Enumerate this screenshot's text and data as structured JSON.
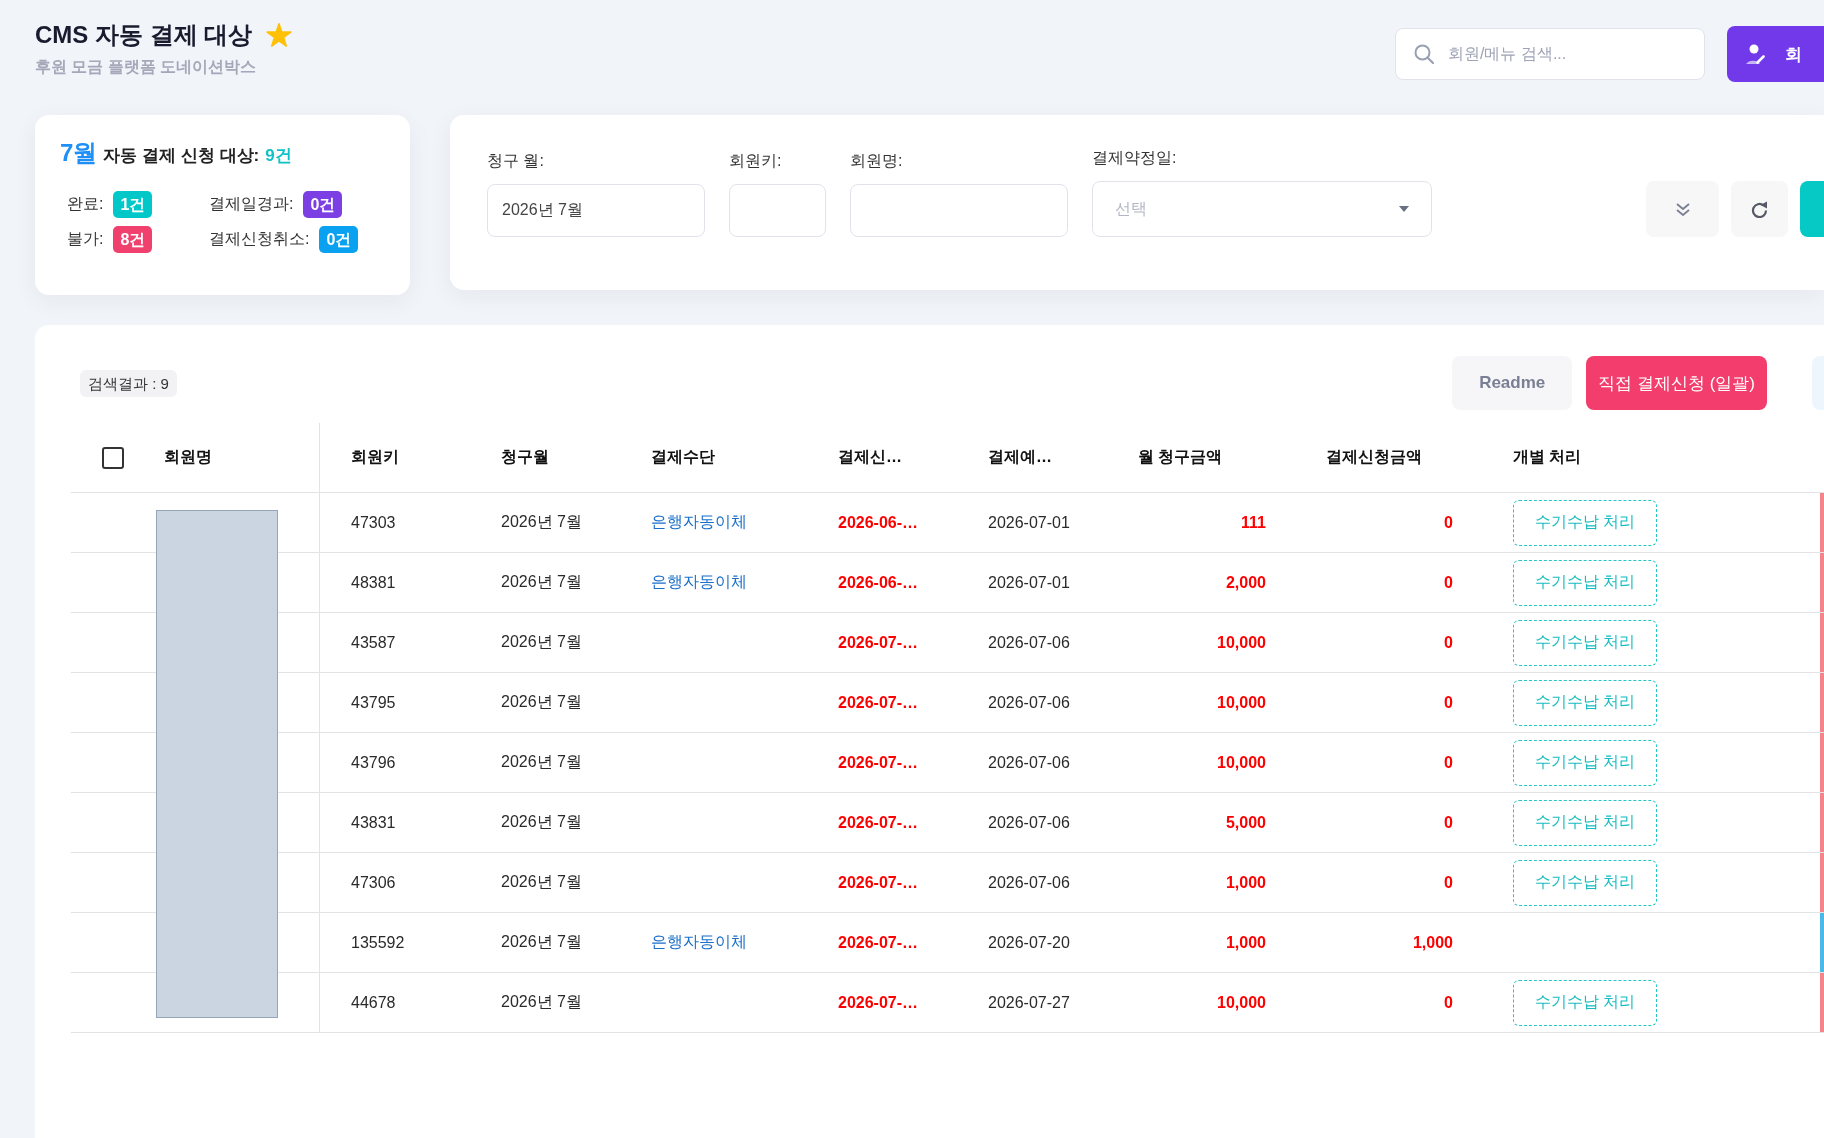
{
  "header": {
    "title": "CMS 자동 결제 대상",
    "favorite": true,
    "subtitle": "후원 모금 플랫폼 도네이션박스",
    "search": {
      "placeholder": "회원/메뉴 검색..."
    },
    "member_button": {
      "label": "회"
    }
  },
  "summary": {
    "month": "7월",
    "title": "자동 결제 신청 대상:",
    "total": "9건",
    "stats": [
      {
        "label": "완료:",
        "count": "1건",
        "color": "#00c8c8"
      },
      {
        "label": "결제일경과:",
        "count": "0건",
        "color": "#7b3fe4"
      },
      {
        "label": "불가:",
        "count": "8건",
        "color": "#f0406e"
      },
      {
        "label": "결제신청취소:",
        "count": "0건",
        "color": "#0aa2f0"
      }
    ]
  },
  "filters": {
    "fields": [
      {
        "kind": "input",
        "label": "청구 월:",
        "value": "2026년 7월"
      },
      {
        "kind": "input",
        "label": "회원키:"
      },
      {
        "kind": "input",
        "label": "회원명:"
      },
      {
        "kind": "select",
        "label": "결제약정일:",
        "placeholder": "선택"
      }
    ]
  },
  "results": {
    "count": "검색결과 : 9",
    "buttons": [
      {
        "kind": "secondary",
        "label": "Readme"
      },
      {
        "kind": "danger",
        "label": "직접 결제신청 (일괄)"
      }
    ]
  },
  "table": {
    "select_all": {
      "checked": false
    },
    "columns": [
      "회원명",
      "회원키",
      "청구월",
      "결제수단",
      "결제신…",
      "결제예…",
      "월 청구금액",
      "결제신청금액",
      "개별 처리"
    ],
    "rows": [
      {
        "member_key": "47303",
        "billing_month": "2026년 7월",
        "payment_method": "은행자동이체",
        "request_date": "2026-06-…",
        "due_date": "2026-07-01",
        "monthly_amount": "111",
        "request_amount": "0",
        "action": "수기수납 처리",
        "color": "#f2848a"
      },
      {
        "member_key": "48381",
        "billing_month": "2026년 7월",
        "payment_method": "은행자동이체",
        "request_date": "2026-06-…",
        "due_date": "2026-07-01",
        "monthly_amount": "2,000",
        "request_amount": "0",
        "action": "수기수납 처리",
        "color": "#f2848a"
      },
      {
        "member_key": "43587",
        "billing_month": "2026년 7월",
        "request_date": "2026-07-…",
        "due_date": "2026-07-06",
        "monthly_amount": "10,000",
        "request_amount": "0",
        "action": "수기수납 처리",
        "color": "#f2848a"
      },
      {
        "member_key": "43795",
        "billing_month": "2026년 7월",
        "request_date": "2026-07-…",
        "due_date": "2026-07-06",
        "monthly_amount": "10,000",
        "request_amount": "0",
        "action": "수기수납 처리",
        "color": "#f2848a"
      },
      {
        "member_key": "43796",
        "billing_month": "2026년 7월",
        "request_date": "2026-07-…",
        "due_date": "2026-07-06",
        "monthly_amount": "10,000",
        "request_amount": "0",
        "action": "수기수납 처리",
        "color": "#f2848a"
      },
      {
        "member_key": "43831",
        "billing_month": "2026년 7월",
        "request_date": "2026-07-…",
        "due_date": "2026-07-06",
        "monthly_amount": "5,000",
        "request_amount": "0",
        "action": "수기수납 처리",
        "color": "#f2848a"
      },
      {
        "member_key": "47306",
        "billing_month": "2026년 7월",
        "request_date": "2026-07-…",
        "due_date": "2026-07-06",
        "monthly_amount": "1,000",
        "request_amount": "0",
        "action": "수기수납 처리",
        "color": "#f2848a"
      },
      {
        "member_key": "135592",
        "billing_month": "2026년 7월",
        "payment_method": "은행자동이체",
        "request_date": "2026-07-…",
        "due_date": "2026-07-20",
        "monthly_amount": "1,000",
        "request_amount": "1,000",
        "color": "#4bb9e8"
      },
      {
        "member_key": "44678",
        "billing_month": "2026년 7월",
        "request_date": "2026-07-…",
        "due_date": "2026-07-27",
        "monthly_amount": "10,000",
        "request_amount": "0",
        "action": "수기수납 처리",
        "color": "#f2848a"
      }
    ]
  }
}
